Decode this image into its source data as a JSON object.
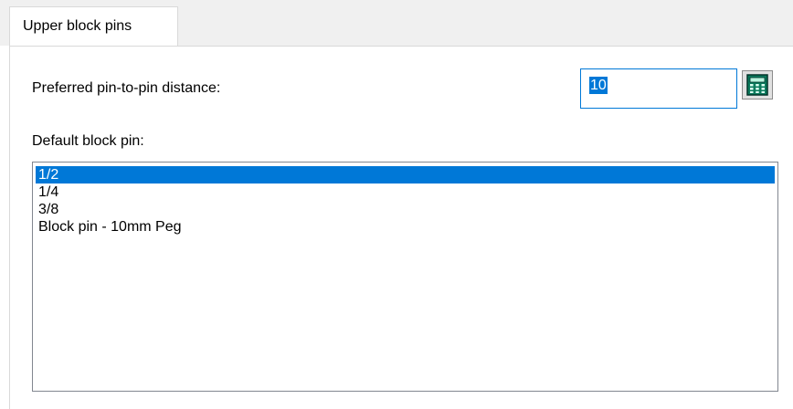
{
  "tab": {
    "label": "Upper block pins"
  },
  "distance": {
    "label": "Preferred pin-to-pin distance:",
    "value": "10",
    "calculator_icon": "calculator-icon"
  },
  "block_pin": {
    "label": "Default block pin:",
    "items": [
      "1/2",
      "1/4",
      "3/8",
      "Block pin - 10mm Peg"
    ],
    "selected_index": 0
  },
  "colors": {
    "selection": "#0078d7",
    "calculator": "#0a7a5c"
  }
}
